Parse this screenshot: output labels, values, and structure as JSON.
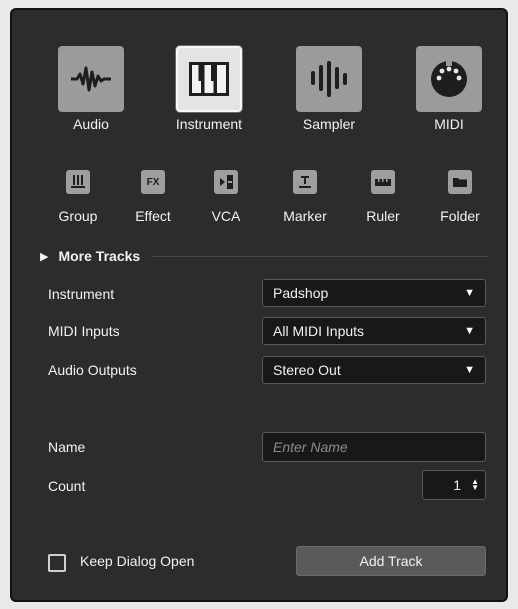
{
  "track_types": [
    {
      "label": "Audio",
      "icon": "waveform-icon",
      "selected": false
    },
    {
      "label": "Instrument",
      "icon": "piano-keys-icon",
      "selected": true
    },
    {
      "label": "Sampler",
      "icon": "sampler-bars-icon",
      "selected": false
    },
    {
      "label": "MIDI",
      "icon": "midi-connector-icon",
      "selected": false
    }
  ],
  "small_types": [
    {
      "label": "Group",
      "icon": "group-icon"
    },
    {
      "label": "Effect",
      "icon": "fx-icon",
      "glyph": "FX"
    },
    {
      "label": "VCA",
      "icon": "vca-icon"
    },
    {
      "label": "Marker",
      "icon": "marker-icon"
    },
    {
      "label": "Ruler",
      "icon": "ruler-icon"
    },
    {
      "label": "Folder",
      "icon": "folder-icon"
    }
  ],
  "more_tracks": {
    "label": "More Tracks"
  },
  "fields": {
    "instrument": {
      "label": "Instrument",
      "value": "Padshop"
    },
    "midi_inputs": {
      "label": "MIDI Inputs",
      "value": "All MIDI Inputs"
    },
    "audio_outputs": {
      "label": "Audio Outputs",
      "value": "Stereo Out"
    },
    "name": {
      "label": "Name",
      "value": "",
      "placeholder": "Enter Name"
    },
    "count": {
      "label": "Count",
      "value": "1"
    }
  },
  "footer": {
    "keep_open_label": "Keep Dialog Open",
    "keep_open_checked": false,
    "add_track_label": "Add Track"
  },
  "colors": {
    "dialog_bg": "#2c2c2c",
    "tile_bg": "#9b9b9b",
    "tile_selected_bg": "#e4e4e4",
    "field_bg": "#181818",
    "button_bg": "#5a5a5a"
  }
}
